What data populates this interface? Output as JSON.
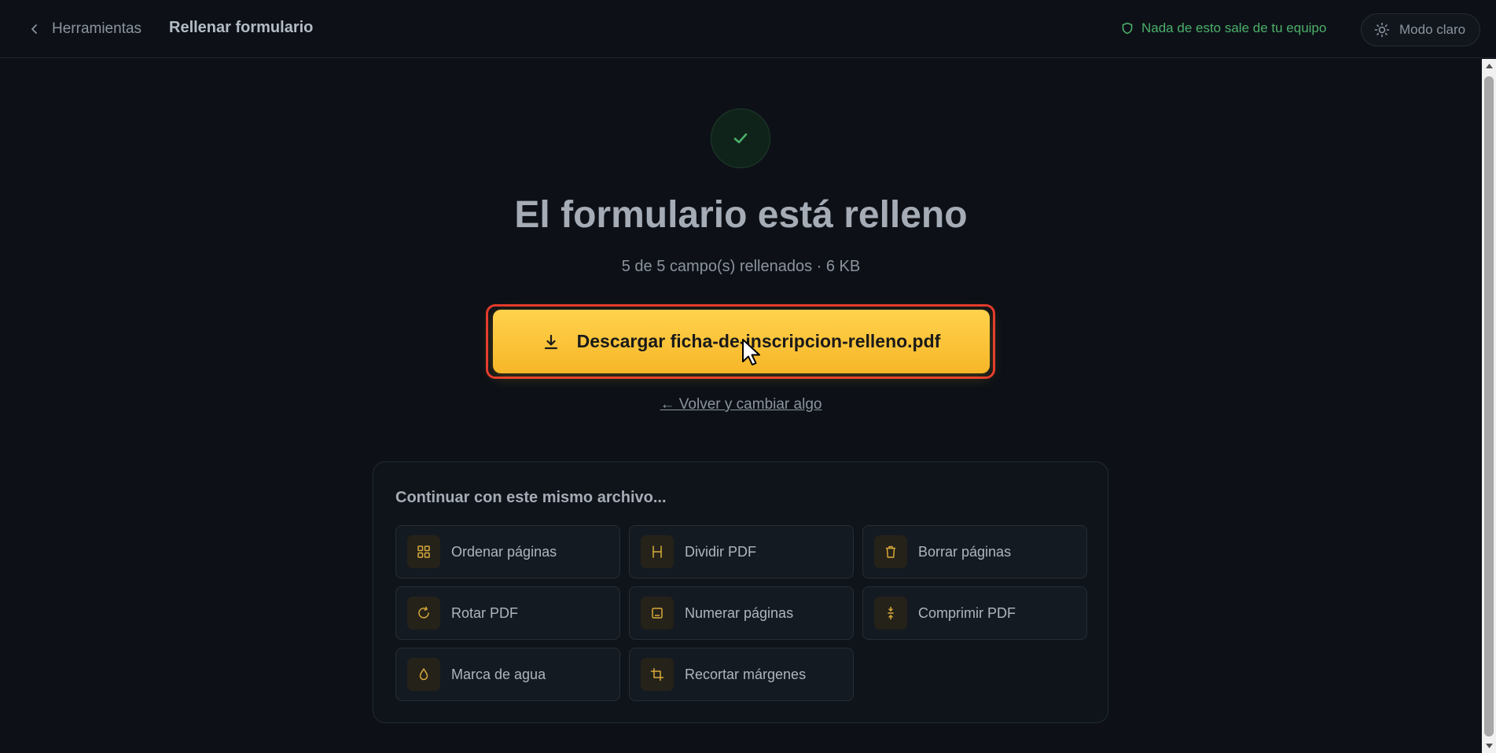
{
  "header": {
    "back_label": "Herramientas",
    "title": "Rellenar formulario",
    "privacy_note": "Nada de esto sale de tu equipo",
    "theme_toggle_label": "Modo claro"
  },
  "result": {
    "headline": "El formulario está relleno",
    "summary": "5 de 5 campo(s) rellenados · 6 KB",
    "download_label": "Descargar ficha-de-inscripcion-relleno.pdf",
    "go_back_label": "← Volver y cambiar algo"
  },
  "continue": {
    "title": "Continuar con este mismo archivo...",
    "tools": [
      {
        "label": "Ordenar páginas",
        "icon": "grid-icon"
      },
      {
        "label": "Dividir PDF",
        "icon": "split-icon"
      },
      {
        "label": "Borrar páginas",
        "icon": "trash-icon"
      },
      {
        "label": "Rotar PDF",
        "icon": "rotate-icon"
      },
      {
        "label": "Numerar páginas",
        "icon": "page-number-icon"
      },
      {
        "label": "Comprimir PDF",
        "icon": "compress-icon"
      },
      {
        "label": "Marca de agua",
        "icon": "droplet-icon"
      },
      {
        "label": "Recortar márgenes",
        "icon": "crop-icon"
      }
    ]
  },
  "colors": {
    "accent": "#f9c23c",
    "success": "#4caf6a",
    "highlight_outline": "#e5382d",
    "background": "#0d1117"
  }
}
